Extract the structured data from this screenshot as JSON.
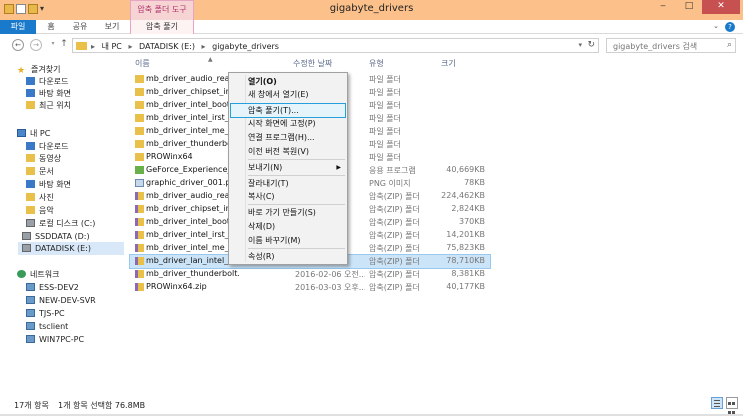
{
  "window": {
    "title": "gigabyte_drivers",
    "tool_tab": "압축 폴더 도구"
  },
  "ribbon": {
    "tabs": [
      "파일",
      "홈",
      "공유",
      "보기",
      "압축 풀기"
    ]
  },
  "address": {
    "crumbs": [
      "내 PC",
      "DATADISK (E:)",
      "gigabyte_drivers"
    ],
    "search_placeholder": "gigabyte_drivers 검색"
  },
  "columns": {
    "name": "이름",
    "date": "수정한 날짜",
    "type": "유형",
    "size": "크기"
  },
  "nav": {
    "favorites": "즐겨찾기",
    "fav_items": [
      "다운로드",
      "바탕 화면",
      "최근 위치"
    ],
    "pc": "내 PC",
    "pc_items": [
      "다운로드",
      "동영상",
      "문서",
      "바탕 화면",
      "사진",
      "음악",
      "로컬 디스크 (C:)",
      "SSDDATA (D:)",
      "DATADISK (E:)"
    ],
    "network": "네트워크",
    "net_items": [
      "ESS-DEV2",
      "NEW-DEV-SVR",
      "TJS-PC",
      "tsclient",
      "WIN7PC-PC"
    ]
  },
  "files": [
    {
      "name": "mb_driver_audio_realtek",
      "date": "",
      "type": "파일 폴더",
      "size": "",
      "icon": "folder"
    },
    {
      "name": "mb_driver_chipset_intel_",
      "date": "",
      "type": "파일 폴더",
      "size": "",
      "icon": "folder"
    },
    {
      "name": "mb_driver_intel_bootdisk",
      "date": "",
      "type": "파일 폴더",
      "size": "",
      "icon": "folder"
    },
    {
      "name": "mb_driver_intel_irst_x99",
      "date": "",
      "type": "파일 폴더",
      "size": "",
      "icon": "folder"
    },
    {
      "name": "mb_driver_intel_me_x99",
      "date": "",
      "type": "파일 폴더",
      "size": "",
      "icon": "folder"
    },
    {
      "name": "mb_driver_thunderbolt",
      "date": "",
      "type": "파일 폴더",
      "size": "",
      "icon": "folder"
    },
    {
      "name": "PROWinx64",
      "date": "",
      "type": "파일 폴더",
      "size": "",
      "icon": "folder"
    },
    {
      "name": "GeForce_Experience_v2.",
      "date": "",
      "type": "응용 프로그램",
      "size": "40,669KB",
      "icon": "exe"
    },
    {
      "name": "graphic_driver_001.png",
      "date": "",
      "type": "PNG 이미지",
      "size": "78KB",
      "icon": "png"
    },
    {
      "name": "mb_driver_audio_realtek",
      "date": "",
      "type": "압축(ZIP) 폴더",
      "size": "224,462KB",
      "icon": "zip"
    },
    {
      "name": "mb_driver_chipset_intel_",
      "date": "",
      "type": "압축(ZIP) 폴더",
      "size": "2,824KB",
      "icon": "zip"
    },
    {
      "name": "mb_driver_intel_bootdisk",
      "date": "",
      "type": "압축(ZIP) 폴더",
      "size": "370KB",
      "icon": "zip"
    },
    {
      "name": "mb_driver_intel_irst_x99",
      "date": "",
      "type": "압축(ZIP) 폴더",
      "size": "14,201KB",
      "icon": "zip"
    },
    {
      "name": "mb_driver_intel_me_x99",
      "date": "",
      "type": "압축(ZIP) 폴더",
      "size": "75,823KB",
      "icon": "zip"
    },
    {
      "name": "mb_driver_lan_intel_x99.zip",
      "date": "",
      "type": "압축(ZIP) 폴더",
      "size": "78,710KB",
      "icon": "zip",
      "selected": true
    },
    {
      "name": "mb_driver_thunderbolt.zip",
      "date": "2016-02-06 오전...",
      "type": "압축(ZIP) 폴더",
      "size": "8,381KB",
      "icon": "zip"
    },
    {
      "name": "PROWinx64.zip",
      "date": "2016-03-03 오후...",
      "type": "압축(ZIP) 폴더",
      "size": "40,177KB",
      "icon": "zip"
    }
  ],
  "context_menu": {
    "items": [
      "열기(O)",
      "새 창에서 열기(E)",
      "압축 풀기(T)...",
      "시작 화면에 고정(P)",
      "연결 프로그램(H)...",
      "이전 버전 복원(V)",
      "보내기(N)",
      "잘라내기(T)",
      "복사(C)",
      "바로 가기 만들기(S)",
      "삭제(D)",
      "이름 바꾸기(M)",
      "속성(R)"
    ]
  },
  "status": {
    "count": "17개 항목",
    "selected": "1개 항목 선택함 76.8MB"
  },
  "colors": {
    "titlebar": "#fcc08a",
    "file_tab": "#1979ca",
    "selection": "#cce4f7",
    "annotation": "#e02020"
  }
}
